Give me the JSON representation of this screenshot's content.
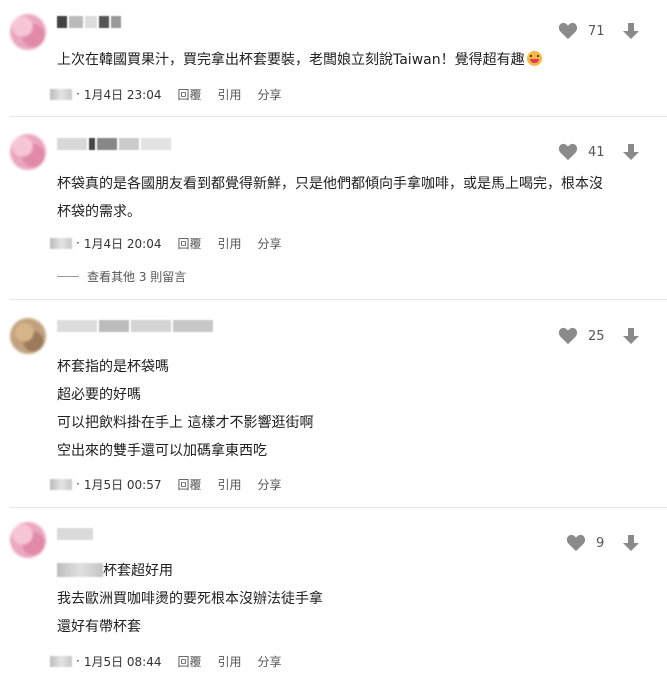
{
  "comments": [
    {
      "likes": "71",
      "lines": [
        "上次在韓國買果汁，買完拿出杯套要裝，老闆娘立刻說Taiwan！覺得超有趣"
      ],
      "date": "1月4日 23:04"
    },
    {
      "likes": "41",
      "lines": [
        "杯袋真的是各國朋友看到都覺得新鮮，只是他們都傾向手拿咖啡，或是馬上喝完，根本沒",
        "杯袋的需求。"
      ],
      "date": "1月4日 20:04",
      "more_replies": "查看其他 3 則留言"
    },
    {
      "likes": "25",
      "lines": [
        "杯套指的是杯袋嗎",
        "超必要的好嗎",
        "可以把飲料掛在手上  這樣才不影響逛街啊",
        "空出來的雙手還可以加碼拿東西吃"
      ],
      "date": "1月5日 00:57"
    },
    {
      "likes": "9",
      "lines": [
        "杯套超好用",
        "我去歐洲買咖啡燙的要死根本沒辦法徒手拿",
        "還好有帶杯套"
      ],
      "date": "1月5日 08:44"
    }
  ],
  "actions": {
    "reply": "回覆",
    "quote": "引用",
    "share": "分享"
  },
  "icons": {
    "like": "heart-icon",
    "dislike": "arrow-down-icon",
    "emoji": "grinning-face-emoji"
  },
  "colors": {
    "icon": "#8a8a8a",
    "text": "#202020",
    "divider": "#e6e6e6"
  }
}
